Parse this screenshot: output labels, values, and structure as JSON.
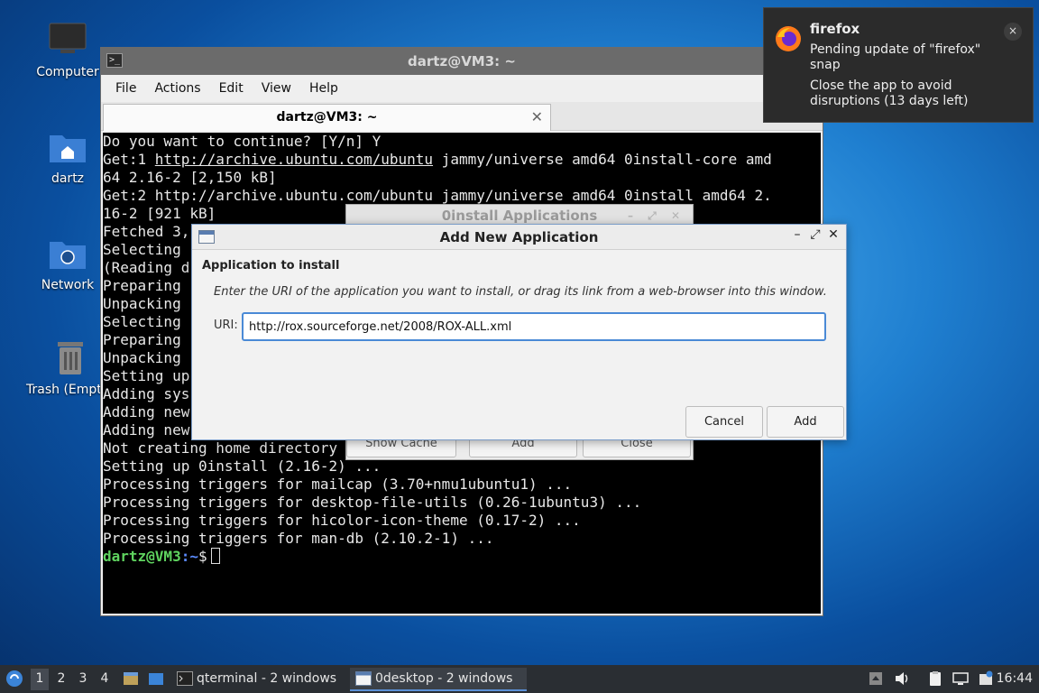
{
  "desktop": {
    "icons": [
      {
        "label": "Computer",
        "icon": "monitor-icon"
      },
      {
        "label": "dartz",
        "icon": "home-folder-icon"
      },
      {
        "label": "Network",
        "icon": "network-folder-icon"
      },
      {
        "label": "Trash (Empty)",
        "icon": "trash-icon"
      }
    ]
  },
  "terminal": {
    "title": "dartz@VM3: ~",
    "menu": [
      "File",
      "Actions",
      "Edit",
      "View",
      "Help"
    ],
    "tab_title": "dartz@VM3: ~",
    "lines": [
      "Do you want to continue? [Y/n] Y",
      "Get:1 http://archive.ubuntu.com/ubuntu jammy/universe amd64 0install-core amd",
      "64 2.16-2 [2,150 kB]",
      "Get:2 http://archive.ubuntu.com/ubuntu jammy/universe amd64 0install amd64 2.",
      "16-2 [921 kB]",
      "Fetched 3,",
      "Selecting",
      "(Reading d",
      "Preparing",
      "Unpacking",
      "Selecting",
      "Preparing",
      "Unpacking",
      "Setting up",
      "Adding sys",
      "Adding new",
      "Adding new",
      "Not creating home directory",
      "Setting up 0install (2.16-2) ...",
      "Processing triggers for mailcap (3.70+nmu1ubuntu1) ...",
      "Processing triggers for desktop-file-utils (0.26-1ubuntu3) ...",
      "Processing triggers for hicolor-icon-theme (0.17-2) ...",
      "Processing triggers for man-db (2.10.2-1) ..."
    ],
    "link_line1": "http://archive.ubuntu.com/ubuntu",
    "prompt_user": "dartz@VM3",
    "prompt_path": ":~",
    "prompt_symbol": "$"
  },
  "zero_install_window": {
    "title": "0install Applications",
    "buttons": [
      "Show Cache",
      "Add",
      "Close"
    ]
  },
  "dialog": {
    "title": "Add New Application",
    "heading": "Application to install",
    "description": "Enter the URI of the application you want to install, or drag its link from a web-browser into this window.",
    "uri_label": "URI:",
    "uri_value": "http://rox.sourceforge.net/2008/ROX-ALL.xml",
    "cancel_label": "Cancel",
    "add_label": "Add"
  },
  "notification": {
    "app": "firefox",
    "body1": "Pending update of \"firefox\" snap",
    "body2": "Close the app to avoid disruptions (13 days left)",
    "close_glyph": "×"
  },
  "taskbar": {
    "workspaces": [
      "1",
      "2",
      "3",
      "4"
    ],
    "active_workspace": "1",
    "tasks": [
      {
        "label": "qterminal - 2 windows"
      },
      {
        "label": "0desktop - 2 windows"
      }
    ],
    "clock": "16:44"
  }
}
